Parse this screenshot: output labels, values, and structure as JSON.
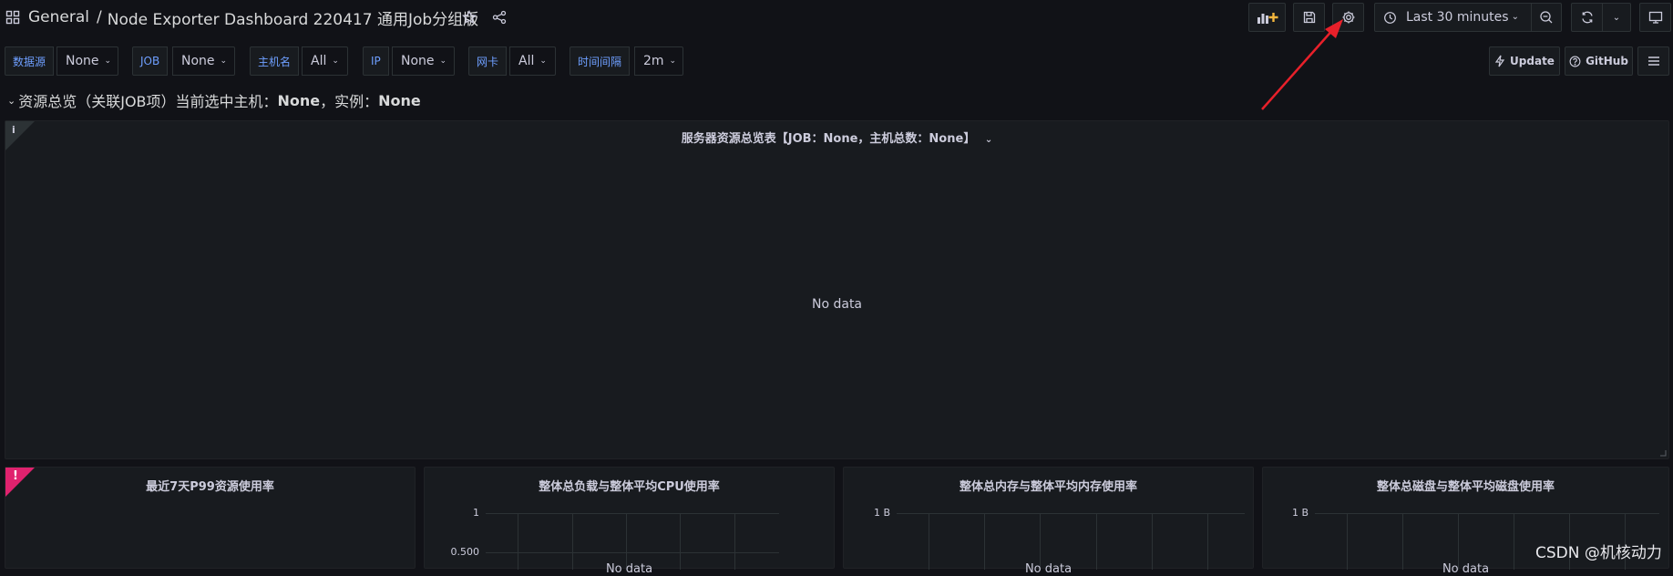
{
  "topbar": {
    "breadcrumb_root": "General",
    "breadcrumb_sep": "/",
    "dashboard_title": "Node Exporter Dashboard 220417 通用Job分组版",
    "time_range": "Last 30 minutes"
  },
  "variables": [
    {
      "label": "数据源",
      "value": "None"
    },
    {
      "label": "JOB",
      "value": "None"
    },
    {
      "label": "主机名",
      "value": "All"
    },
    {
      "label": "IP",
      "value": "None"
    },
    {
      "label": "网卡",
      "value": "All"
    },
    {
      "label": "时间间隔",
      "value": "2m"
    }
  ],
  "links": {
    "update": "Update",
    "github": "GitHub"
  },
  "row": {
    "title_prefix": "资源总览（关联JOB项）当前选中主机：",
    "host": "None",
    "instance_label": "，实例：",
    "instance": "None"
  },
  "overview_panel": {
    "title": "服务器资源总览表【JOB：None，主机总数：None】",
    "info_glyph": "i",
    "no_data": "No data"
  },
  "panels": [
    {
      "title": "最近7天P99资源使用率",
      "error_glyph": "!"
    },
    {
      "title": "整体总负载与整体平均CPU使用率",
      "ticks": [
        "1",
        "0.500"
      ],
      "partial_text": "No data"
    },
    {
      "title": "整体总内存与整体平均内存使用率",
      "ticks": [
        "1 B"
      ],
      "partial_text": "No data"
    },
    {
      "title": "整体总磁盘与整体平均磁盘使用率",
      "ticks": [
        "1 B"
      ],
      "partial_text": "No data"
    }
  ],
  "watermark": "CSDN @机核动力",
  "colors": {
    "background": "#111217",
    "panel": "#181b1f",
    "variable_label": "#6e9fff",
    "error_corner": "#e0226e",
    "annotation_arrow": "#e8202a"
  }
}
